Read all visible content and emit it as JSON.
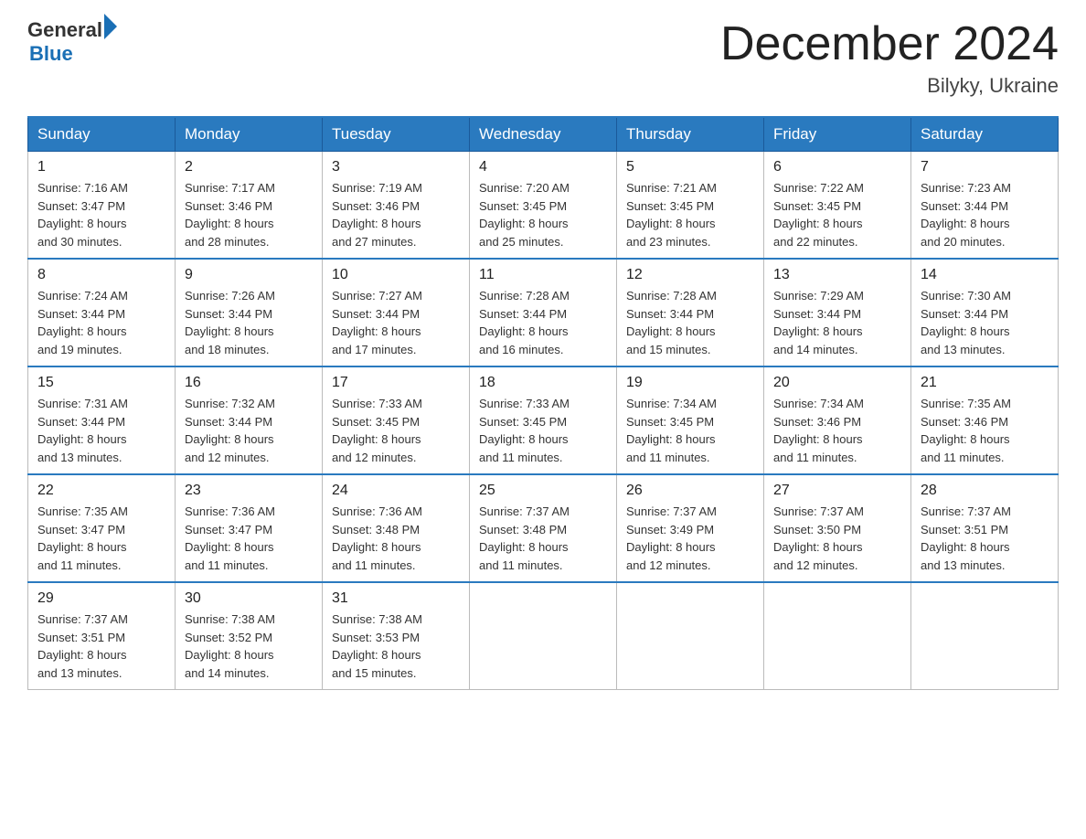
{
  "header": {
    "logo_general": "General",
    "logo_blue": "Blue",
    "month_title": "December 2024",
    "location": "Bilyky, Ukraine"
  },
  "days_of_week": [
    "Sunday",
    "Monday",
    "Tuesday",
    "Wednesday",
    "Thursday",
    "Friday",
    "Saturday"
  ],
  "weeks": [
    [
      {
        "day": "1",
        "sunrise": "7:16 AM",
        "sunset": "3:47 PM",
        "daylight": "8 hours and 30 minutes."
      },
      {
        "day": "2",
        "sunrise": "7:17 AM",
        "sunset": "3:46 PM",
        "daylight": "8 hours and 28 minutes."
      },
      {
        "day": "3",
        "sunrise": "7:19 AM",
        "sunset": "3:46 PM",
        "daylight": "8 hours and 27 minutes."
      },
      {
        "day": "4",
        "sunrise": "7:20 AM",
        "sunset": "3:45 PM",
        "daylight": "8 hours and 25 minutes."
      },
      {
        "day": "5",
        "sunrise": "7:21 AM",
        "sunset": "3:45 PM",
        "daylight": "8 hours and 23 minutes."
      },
      {
        "day": "6",
        "sunrise": "7:22 AM",
        "sunset": "3:45 PM",
        "daylight": "8 hours and 22 minutes."
      },
      {
        "day": "7",
        "sunrise": "7:23 AM",
        "sunset": "3:44 PM",
        "daylight": "8 hours and 20 minutes."
      }
    ],
    [
      {
        "day": "8",
        "sunrise": "7:24 AM",
        "sunset": "3:44 PM",
        "daylight": "8 hours and 19 minutes."
      },
      {
        "day": "9",
        "sunrise": "7:26 AM",
        "sunset": "3:44 PM",
        "daylight": "8 hours and 18 minutes."
      },
      {
        "day": "10",
        "sunrise": "7:27 AM",
        "sunset": "3:44 PM",
        "daylight": "8 hours and 17 minutes."
      },
      {
        "day": "11",
        "sunrise": "7:28 AM",
        "sunset": "3:44 PM",
        "daylight": "8 hours and 16 minutes."
      },
      {
        "day": "12",
        "sunrise": "7:28 AM",
        "sunset": "3:44 PM",
        "daylight": "8 hours and 15 minutes."
      },
      {
        "day": "13",
        "sunrise": "7:29 AM",
        "sunset": "3:44 PM",
        "daylight": "8 hours and 14 minutes."
      },
      {
        "day": "14",
        "sunrise": "7:30 AM",
        "sunset": "3:44 PM",
        "daylight": "8 hours and 13 minutes."
      }
    ],
    [
      {
        "day": "15",
        "sunrise": "7:31 AM",
        "sunset": "3:44 PM",
        "daylight": "8 hours and 13 minutes."
      },
      {
        "day": "16",
        "sunrise": "7:32 AM",
        "sunset": "3:44 PM",
        "daylight": "8 hours and 12 minutes."
      },
      {
        "day": "17",
        "sunrise": "7:33 AM",
        "sunset": "3:45 PM",
        "daylight": "8 hours and 12 minutes."
      },
      {
        "day": "18",
        "sunrise": "7:33 AM",
        "sunset": "3:45 PM",
        "daylight": "8 hours and 11 minutes."
      },
      {
        "day": "19",
        "sunrise": "7:34 AM",
        "sunset": "3:45 PM",
        "daylight": "8 hours and 11 minutes."
      },
      {
        "day": "20",
        "sunrise": "7:34 AM",
        "sunset": "3:46 PM",
        "daylight": "8 hours and 11 minutes."
      },
      {
        "day": "21",
        "sunrise": "7:35 AM",
        "sunset": "3:46 PM",
        "daylight": "8 hours and 11 minutes."
      }
    ],
    [
      {
        "day": "22",
        "sunrise": "7:35 AM",
        "sunset": "3:47 PM",
        "daylight": "8 hours and 11 minutes."
      },
      {
        "day": "23",
        "sunrise": "7:36 AM",
        "sunset": "3:47 PM",
        "daylight": "8 hours and 11 minutes."
      },
      {
        "day": "24",
        "sunrise": "7:36 AM",
        "sunset": "3:48 PM",
        "daylight": "8 hours and 11 minutes."
      },
      {
        "day": "25",
        "sunrise": "7:37 AM",
        "sunset": "3:48 PM",
        "daylight": "8 hours and 11 minutes."
      },
      {
        "day": "26",
        "sunrise": "7:37 AM",
        "sunset": "3:49 PM",
        "daylight": "8 hours and 12 minutes."
      },
      {
        "day": "27",
        "sunrise": "7:37 AM",
        "sunset": "3:50 PM",
        "daylight": "8 hours and 12 minutes."
      },
      {
        "day": "28",
        "sunrise": "7:37 AM",
        "sunset": "3:51 PM",
        "daylight": "8 hours and 13 minutes."
      }
    ],
    [
      {
        "day": "29",
        "sunrise": "7:37 AM",
        "sunset": "3:51 PM",
        "daylight": "8 hours and 13 minutes."
      },
      {
        "day": "30",
        "sunrise": "7:38 AM",
        "sunset": "3:52 PM",
        "daylight": "8 hours and 14 minutes."
      },
      {
        "day": "31",
        "sunrise": "7:38 AM",
        "sunset": "3:53 PM",
        "daylight": "8 hours and 15 minutes."
      },
      null,
      null,
      null,
      null
    ]
  ],
  "labels": {
    "sunrise": "Sunrise:",
    "sunset": "Sunset:",
    "daylight": "Daylight:"
  }
}
